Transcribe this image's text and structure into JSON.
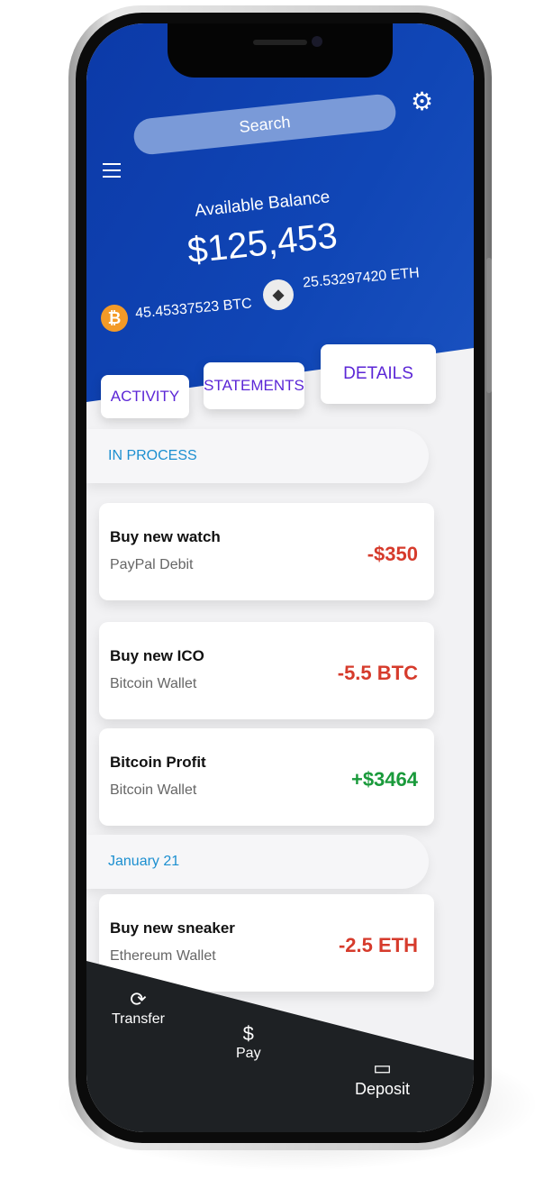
{
  "header": {
    "search_placeholder": "Search",
    "balance_label": "Available Balance",
    "balance": "$125,453",
    "btc_amount": "45.45337523 BTC",
    "eth_amount": "25.53297420 ETH"
  },
  "tabs": [
    {
      "label": "ACTIVITY"
    },
    {
      "label": "STATEMENTS"
    },
    {
      "label": "DETAILS"
    }
  ],
  "sections": [
    {
      "title": "IN PROCESS",
      "items": [
        {
          "title": "Buy new watch",
          "subtitle": "PayPal Debit",
          "amount": "-$350"
        },
        {
          "title": "Buy new ICO",
          "subtitle": "Bitcoin Wallet",
          "amount": "-5.5 BTC"
        },
        {
          "title": "Bitcoin Profit",
          "subtitle": "Bitcoin Wallet",
          "amount": "+$3464"
        }
      ]
    },
    {
      "title": "January 21",
      "items": [
        {
          "title": "Buy new sneaker",
          "subtitle": "Ethereum Wallet",
          "amount": "-2.5 ETH"
        }
      ]
    }
  ],
  "nav": [
    {
      "label": "Transfer",
      "icon": "refresh-icon"
    },
    {
      "label": "Pay",
      "icon": "currency-exchange-icon"
    },
    {
      "label": "Deposit",
      "icon": "credit-card-icon"
    }
  ],
  "colors": {
    "header": "#1046b6",
    "accent": "#5b26d6",
    "negative": "#d63b2c",
    "positive": "#1a9a3b",
    "section": "#1c8fd0",
    "nav": "#1e2124"
  }
}
